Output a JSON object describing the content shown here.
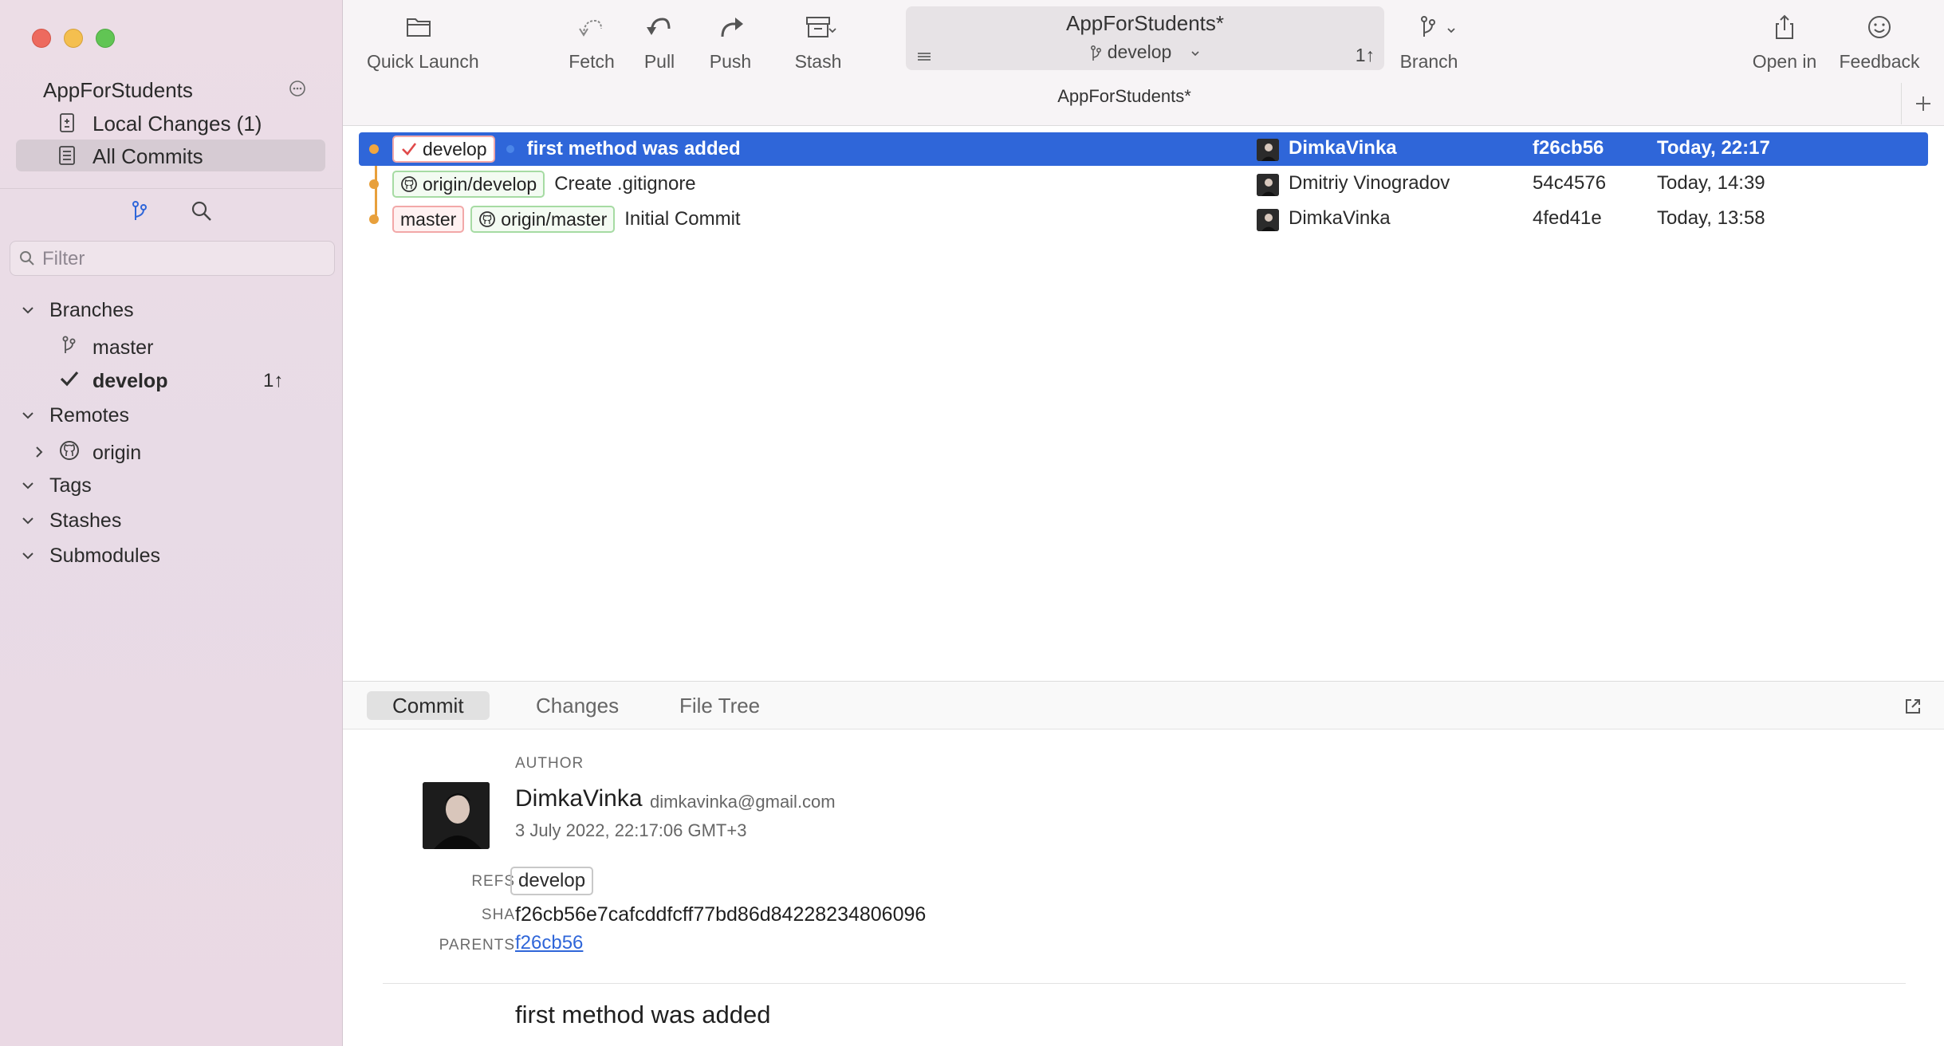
{
  "sidebar": {
    "repo_name": "AppForStudents",
    "nav": [
      {
        "label": "Local Changes (1)",
        "icon": "local-changes-icon"
      },
      {
        "label": "All Commits",
        "icon": "all-commits-icon",
        "selected": true
      }
    ],
    "filter_placeholder": "Filter",
    "sections": {
      "branches": "Branches",
      "remotes": "Remotes",
      "tags": "Tags",
      "stashes": "Stashes",
      "submodules": "Submodules"
    },
    "branches": [
      {
        "name": "master",
        "current": false,
        "ahead": ""
      },
      {
        "name": "develop",
        "current": true,
        "ahead": "1↑"
      }
    ],
    "remotes": [
      {
        "name": "origin"
      }
    ]
  },
  "toolbar": {
    "quick_launch": "Quick Launch",
    "fetch": "Fetch",
    "pull": "Pull",
    "push": "Push",
    "stash": "Stash",
    "branch": "Branch",
    "open_in": "Open in",
    "feedback": "Feedback",
    "repo_title": "AppForStudents*",
    "current_branch": "develop",
    "ahead": "1↑",
    "window_tab": "AppForStudents*"
  },
  "commits": [
    {
      "message": "first method was added",
      "author": "DimkaVinka",
      "sha": "f26cb56",
      "date": "Today, 22:17",
      "refs": [
        "develop"
      ]
    },
    {
      "message": "Create .gitignore",
      "author": "Dmitriy Vinogradov",
      "sha": "54c4576",
      "date": "Today, 14:39",
      "refs": [
        "origin/develop"
      ]
    },
    {
      "message": "Initial Commit",
      "author": "DimkaVinka",
      "sha": "4fed41e",
      "date": "Today, 13:58",
      "refs": [
        "master",
        "origin/master"
      ]
    }
  ],
  "detail": {
    "tabs": [
      "Commit",
      "Changes",
      "File Tree"
    ],
    "author_label": "AUTHOR",
    "author_name": "DimkaVinka",
    "author_email": "dimkavinka@gmail.com",
    "author_date": "3 July 2022, 22:17:06 GMT+3",
    "refs_label": "REFS",
    "refs_value": "develop",
    "sha_label": "SHA",
    "sha_value": "f26cb56e7cafcddfcff77bd86d84228234806096",
    "parents_label": "PARENTS",
    "parent": "f26cb56",
    "message": "first method was added"
  },
  "colors": {
    "selection": "#2f66d9",
    "graph": "#e8a03b",
    "local_ref_border": "#f2a8a8",
    "remote_ref_border": "#a6dba3"
  }
}
